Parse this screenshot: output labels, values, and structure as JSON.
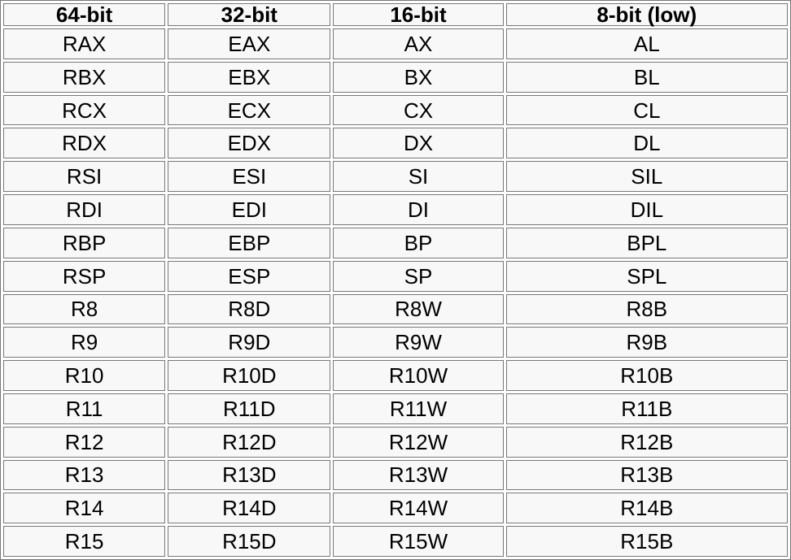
{
  "table": {
    "headers": [
      "64-bit",
      "32-bit",
      "16-bit",
      "8-bit (low)"
    ],
    "rows": [
      [
        "RAX",
        "EAX",
        "AX",
        "AL"
      ],
      [
        "RBX",
        "EBX",
        "BX",
        "BL"
      ],
      [
        "RCX",
        "ECX",
        "CX",
        "CL"
      ],
      [
        "RDX",
        "EDX",
        "DX",
        "DL"
      ],
      [
        "RSI",
        "ESI",
        "SI",
        "SIL"
      ],
      [
        "RDI",
        "EDI",
        "DI",
        "DIL"
      ],
      [
        "RBP",
        "EBP",
        "BP",
        "BPL"
      ],
      [
        "RSP",
        "ESP",
        "SP",
        "SPL"
      ],
      [
        "R8",
        "R8D",
        "R8W",
        "R8B"
      ],
      [
        "R9",
        "R9D",
        "R9W",
        "R9B"
      ],
      [
        "R10",
        "R10D",
        "R10W",
        "R10B"
      ],
      [
        "R11",
        "R11D",
        "R11W",
        "R11B"
      ],
      [
        "R12",
        "R12D",
        "R12W",
        "R12B"
      ],
      [
        "R13",
        "R13D",
        "R13W",
        "R13B"
      ],
      [
        "R14",
        "R14D",
        "R14W",
        "R14B"
      ],
      [
        "R15",
        "R15D",
        "R15W",
        "R15B"
      ]
    ]
  },
  "colors": {
    "cell_background": "#f8f8f8",
    "border": "#777777",
    "text": "#000000"
  }
}
